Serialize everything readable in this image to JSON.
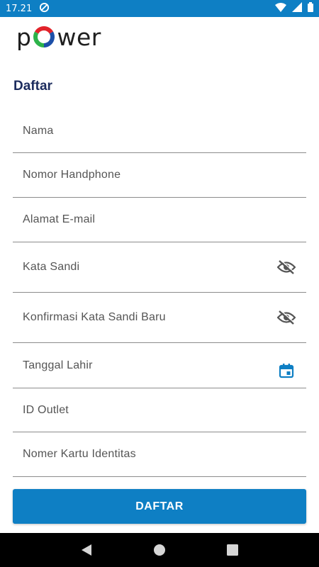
{
  "status_bar": {
    "time": "17.21"
  },
  "logo": {
    "text_start": "p",
    "text_end": "wer"
  },
  "page": {
    "title": "Daftar"
  },
  "form": {
    "fields": [
      {
        "label": "Nama"
      },
      {
        "label": "Nomor Handphone"
      },
      {
        "label": "Alamat E-mail"
      },
      {
        "label": "Kata Sandi",
        "icon": "visibility-off-icon"
      },
      {
        "label": "Konfirmasi Kata Sandi Baru",
        "icon": "visibility-off-icon"
      },
      {
        "label": "Tanggal Lahir",
        "icon": "calendar-icon"
      },
      {
        "label": "ID Outlet"
      },
      {
        "label": "Nomer Kartu Identitas"
      }
    ],
    "submit_label": "DAFTAR"
  },
  "colors": {
    "primary": "#0e7fc4",
    "title": "#1c2c5e",
    "label": "#555555",
    "divider": "#8c8c8c"
  }
}
